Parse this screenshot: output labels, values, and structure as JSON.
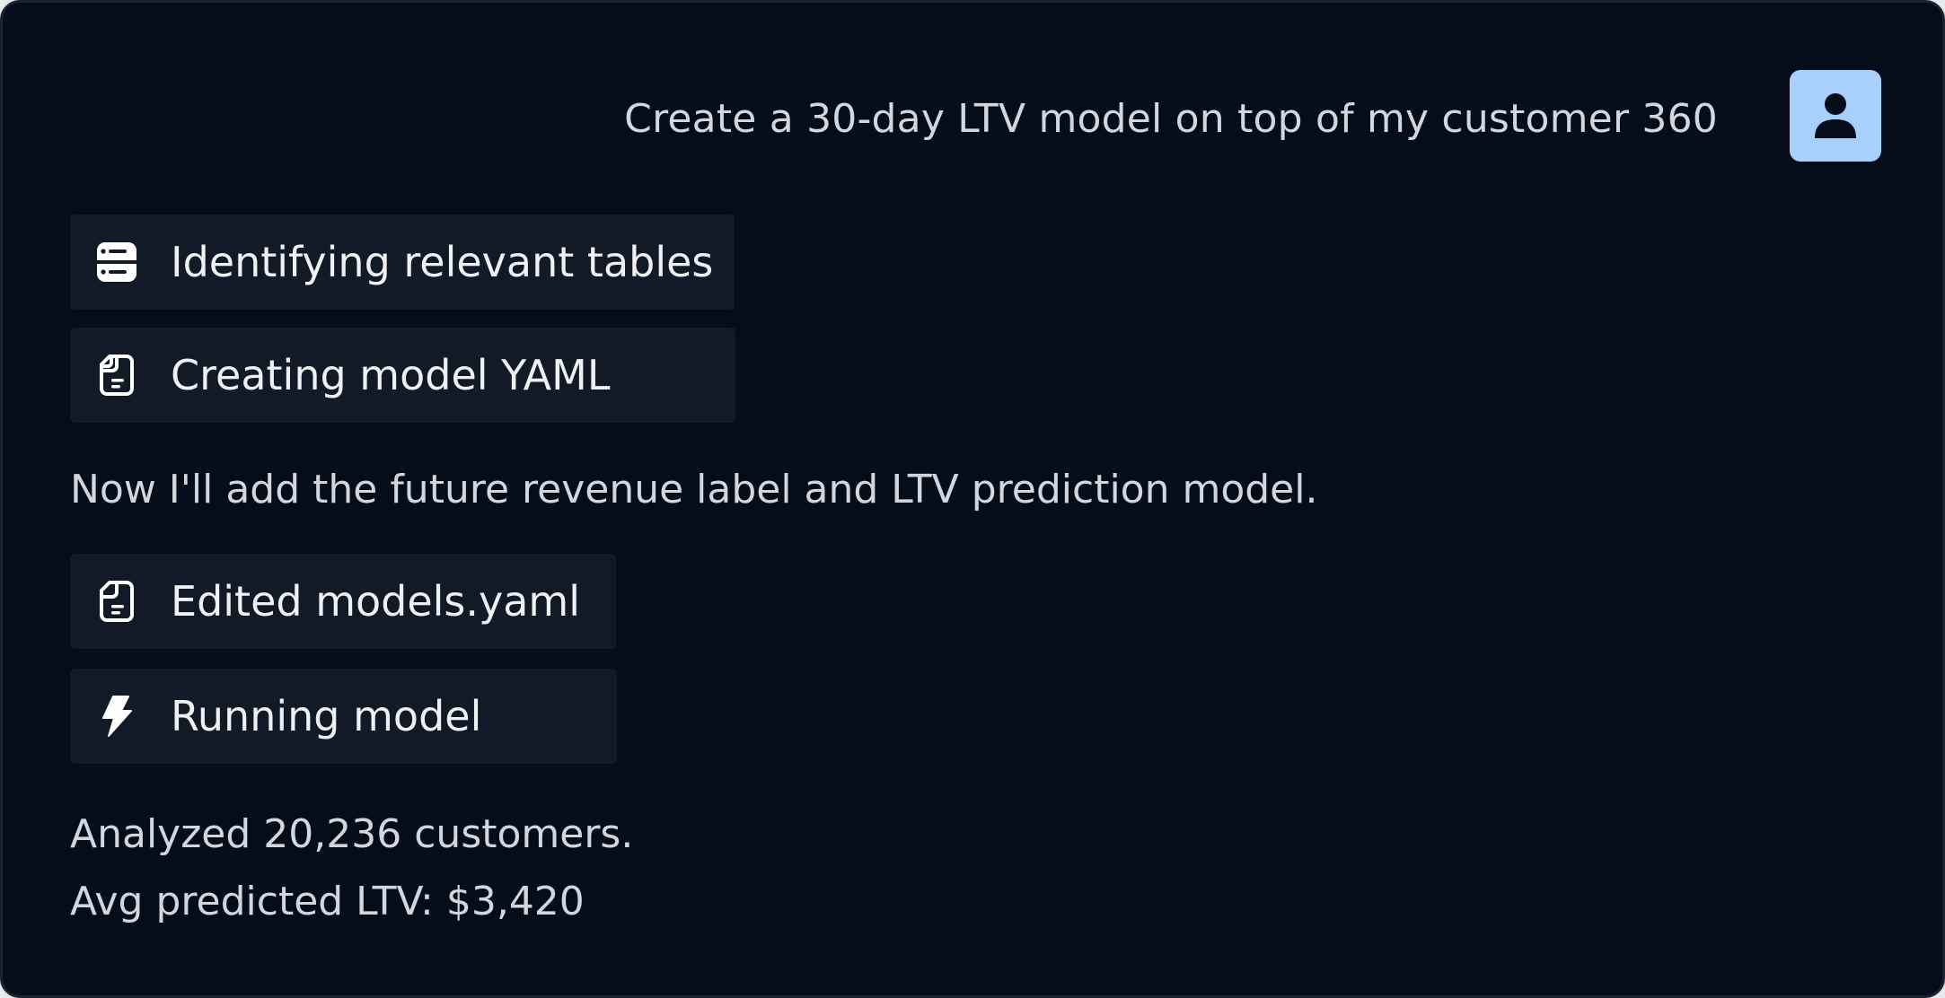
{
  "conversation": {
    "user_prompt": "Create a 30-day LTV model on top of my customer 360",
    "avatar_icon": "user-icon",
    "steps_group_1": [
      {
        "icon": "table-icon",
        "label": "Identifying relevant tables"
      },
      {
        "icon": "file-icon",
        "label": "Creating model YAML"
      }
    ],
    "assistant_message_1": "Now I'll add the future revenue label and LTV prediction model.",
    "steps_group_2": [
      {
        "icon": "file-icon",
        "label": "Edited models.yaml"
      },
      {
        "icon": "lightning-icon",
        "label": "Running model"
      }
    ],
    "result_lines": [
      "Analyzed 20,236 customers.",
      "Avg predicted LTV: $3,420"
    ]
  },
  "colors": {
    "background": "#060d1a",
    "chip": "#121a27",
    "avatar": "#a9cffc",
    "text": "#d3d6dc",
    "chip_text": "#eef0f3"
  }
}
